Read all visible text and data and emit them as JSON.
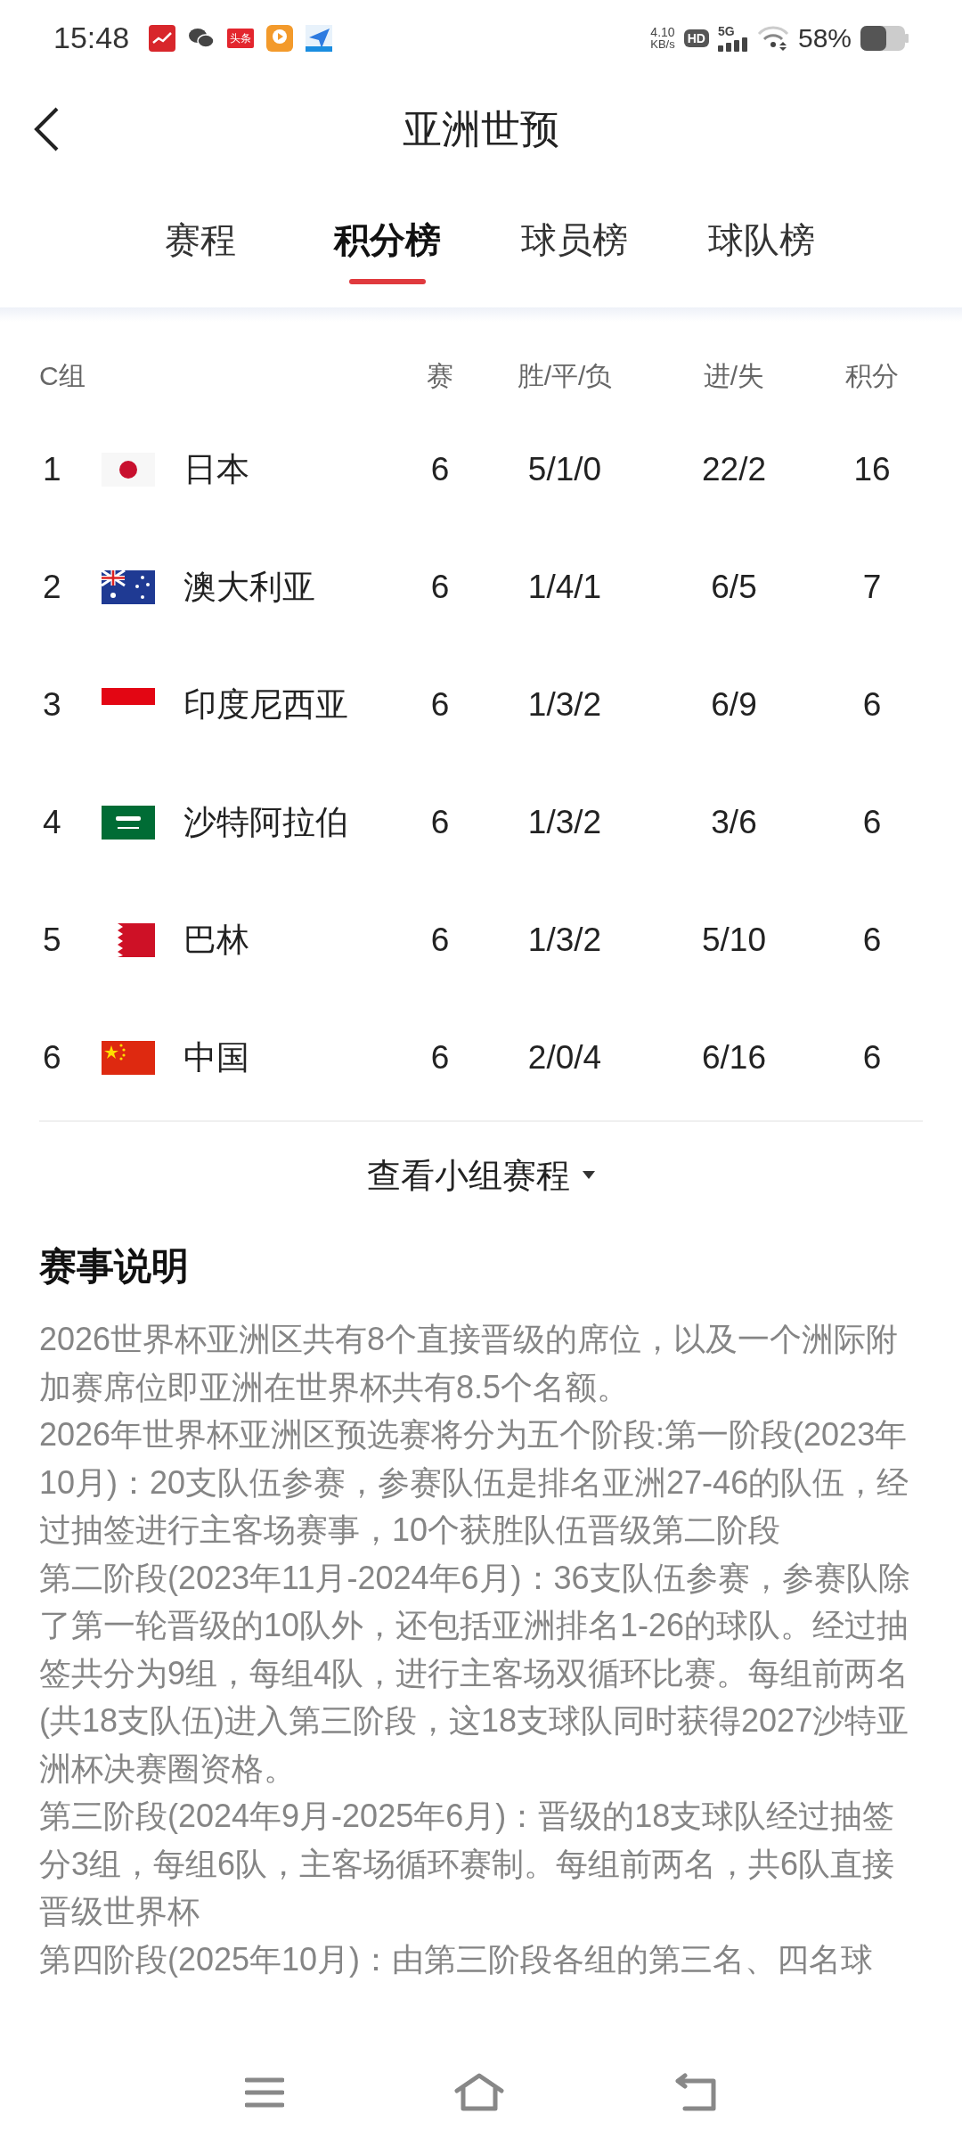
{
  "status_bar": {
    "time": "15:48",
    "notification_badge": "头条",
    "net_speed": [
      "4.10",
      "KB/s"
    ],
    "hd": "HD",
    "network": "5G",
    "battery": "58%"
  },
  "header": {
    "title": "亚洲世预"
  },
  "tabs": [
    {
      "label": "赛程",
      "selected": false
    },
    {
      "label": "积分榜",
      "selected": true
    },
    {
      "label": "球员榜",
      "selected": false
    },
    {
      "label": "球队榜",
      "selected": false
    }
  ],
  "table": {
    "columns": [
      "C组",
      "赛",
      "胜/平/负",
      "进/失",
      "积分"
    ],
    "rows": [
      {
        "rank": "1",
        "kind": "japan",
        "team": "日本",
        "played": "6",
        "record": "5/1/0",
        "goals": "22/2",
        "points": "16"
      },
      {
        "rank": "2",
        "kind": "australia",
        "team": "澳大利亚",
        "played": "6",
        "record": "1/4/1",
        "goals": "6/5",
        "points": "7"
      },
      {
        "rank": "3",
        "kind": "indonesia",
        "team": "印度尼西亚",
        "played": "6",
        "record": "1/3/2",
        "goals": "6/9",
        "points": "6"
      },
      {
        "rank": "4",
        "kind": "saudi",
        "team": "沙特阿拉伯",
        "played": "6",
        "record": "1/3/2",
        "goals": "3/6",
        "points": "6"
      },
      {
        "rank": "5",
        "kind": "bahrain",
        "team": "巴林",
        "played": "6",
        "record": "1/3/2",
        "goals": "5/10",
        "points": "6"
      },
      {
        "rank": "6",
        "kind": "china",
        "team": "中国",
        "played": "6",
        "record": "2/0/4",
        "goals": "6/16",
        "points": "6"
      }
    ]
  },
  "schedule_link": "查看小组赛程",
  "description": {
    "title": "赛事说明",
    "paragraphs": [
      "2026世界杯亚洲区共有8个直接晋级的席位，以及一个洲际附加赛席位即亚洲在世界杯共有8.5个名额。",
      "2026年世界杯亚洲区预选赛将分为五个阶段:第一阶段(2023年10月)：20支队伍参赛，参赛队伍是排名亚洲27-46的队伍，经过抽签进行主客场赛事，10个获胜队伍晋级第二阶段",
      "第二阶段(2023年11月-2024年6月)：36支队伍参赛，参赛队除了第一轮晋级的10队外，还包括亚洲排名1-26的球队。经过抽签共分为9组，每组4队，进行主客场双循环比赛。每组前两名(共18支队伍)进入第三阶段，这18支球队同时获得2027沙特亚洲杯决赛圈资格。",
      "第三阶段(2024年9月-2025年6月)：晋级的18支球队经过抽签分3组，每组6队，主客场循环赛制。每组前两名，共6队直接晋级世界杯",
      "第四阶段(2025年10月)：由第三阶段各组的第三名、四名球"
    ]
  }
}
